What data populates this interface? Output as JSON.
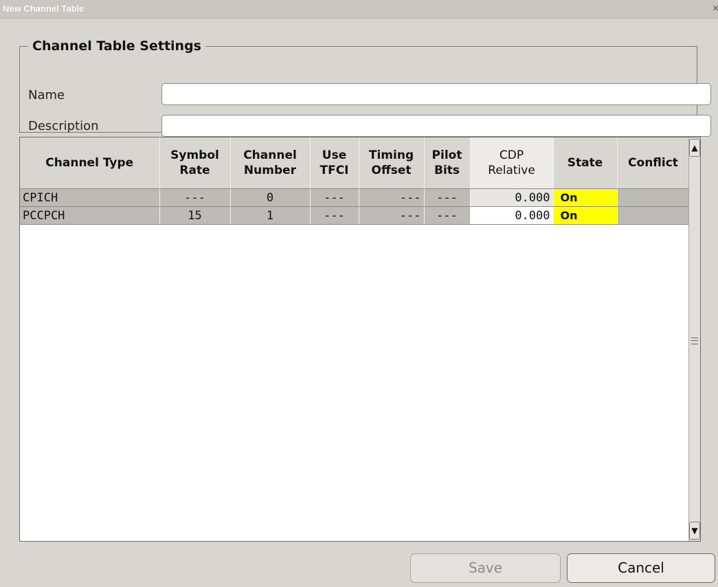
{
  "window": {
    "title": "New Channel Table",
    "close_label": "×"
  },
  "settings": {
    "legend": "Channel Table Settings",
    "name_label": "Name",
    "name_value": "",
    "description_label": "Description",
    "description_value": ""
  },
  "table": {
    "headers": [
      [
        "Channel Type"
      ],
      [
        "Symbol",
        "Rate"
      ],
      [
        "Channel",
        "Number"
      ],
      [
        "Use",
        "TFCI"
      ],
      [
        "Timing",
        "Offset"
      ],
      [
        "Pilot",
        "Bits"
      ],
      [
        "CDP",
        "Relative"
      ],
      [
        "State"
      ],
      [
        "Conflict"
      ]
    ],
    "rows": [
      [
        "CPICH",
        "---",
        "0",
        "---",
        "---",
        "---",
        "0.000",
        "On",
        ""
      ],
      [
        "PCCPCH",
        "15",
        "1",
        "---",
        "---",
        "---",
        "0.000",
        "On",
        ""
      ]
    ]
  },
  "scrollbar": {
    "up_icon": "arrow-up-icon",
    "down_icon": "arrow-down-icon",
    "grip_icon": "scroll-grip-icon"
  },
  "buttons": {
    "save": "Save",
    "cancel": "Cancel"
  },
  "colors": {
    "state_on": "#ffff00",
    "background": "#d8d6d1",
    "table_cell": "#bdbbb6"
  }
}
